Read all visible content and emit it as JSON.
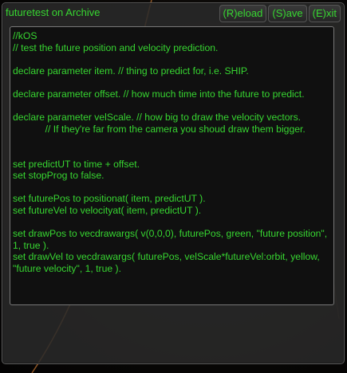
{
  "window": {
    "title": "futuretest on Archive",
    "buttons": {
      "reload": "(R)eload",
      "save": "(S)ave",
      "exit": "(E)xit"
    }
  },
  "editor": {
    "content": "//kOS\n// test the future position and velocity prediction.\n\ndeclare parameter item. // thing to predict for, i.e. SHIP.\n\ndeclare parameter offset. // how much time into the future to predict.\n\ndeclare parameter velScale. // how big to draw the velocity vectors.\n            // If they're far from the camera you shoud draw them bigger.\n\n\nset predictUT to time + offset.\nset stopProg to false.\n\nset futurePos to positionat( item, predictUT ).\nset futureVel to velocityat( item, predictUT ).\n\nset drawPos to vecdrawargs( v(0,0,0), futurePos, green, \"future position\", 1, true ).\nset drawVel to vecdrawargs( futurePos, velScale*futureVel:orbit, yellow, \"future velocity\", 1, true )."
  },
  "colors": {
    "text": "#37d631",
    "panel": "#2a2a2a",
    "editor_bg": "#101010",
    "orbit_line": "#b06a2e"
  }
}
